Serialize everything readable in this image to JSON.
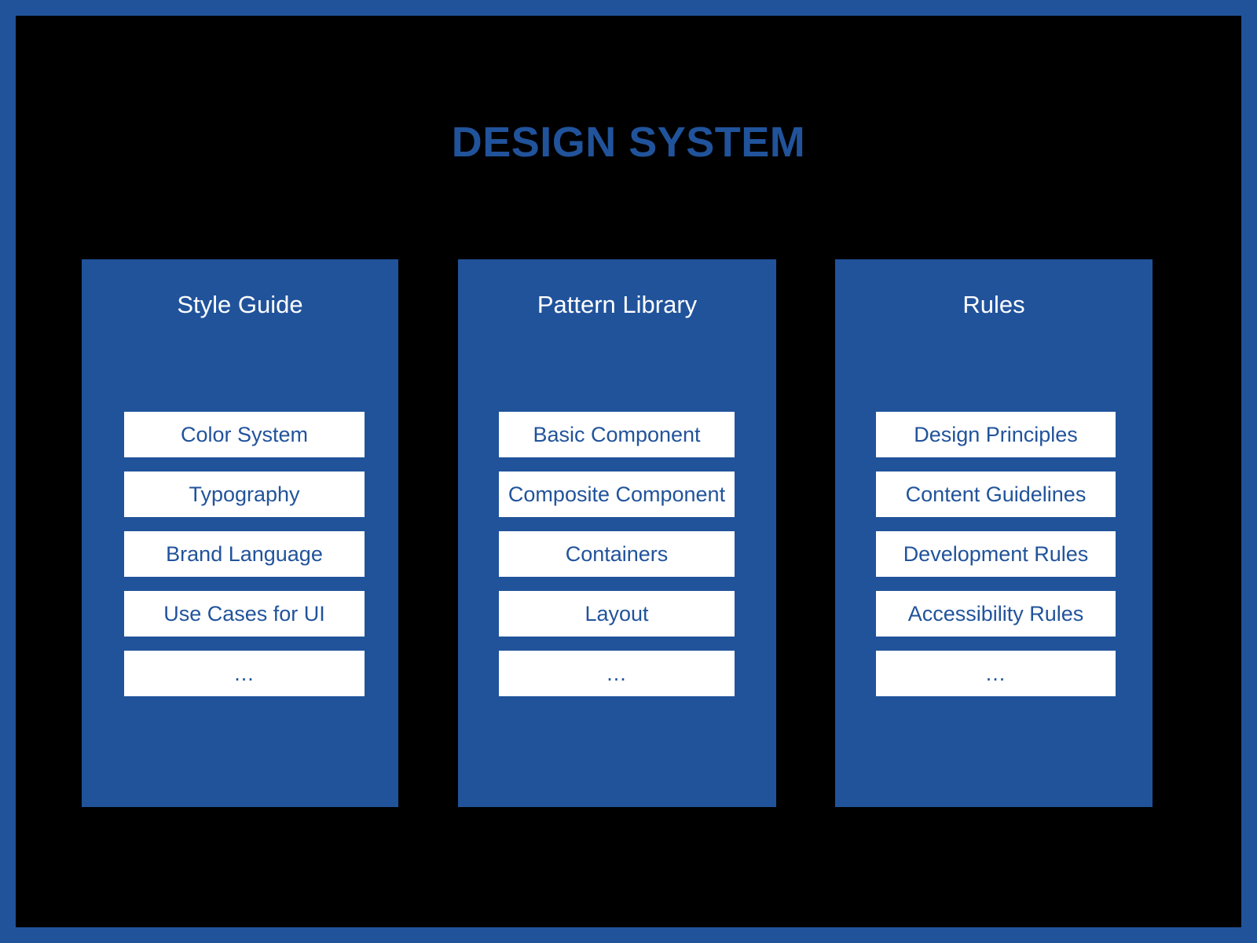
{
  "page": {
    "title": "DESIGN SYSTEM",
    "background_color": "#000000",
    "border_color": "#21539b",
    "accent_color": "#21539b",
    "card_text_color": "#ffffff",
    "item_text_color": "#21539b",
    "item_background_color": "#ffffff"
  },
  "columns": [
    {
      "title": "Style Guide",
      "items": [
        {
          "label": "Color System"
        },
        {
          "label": "Typography"
        },
        {
          "label": "Brand Language"
        },
        {
          "label": "Use Cases for UI"
        },
        {
          "label": "..."
        }
      ]
    },
    {
      "title": "Pattern Library",
      "items": [
        {
          "label": "Basic Component"
        },
        {
          "label": "Composite Component"
        },
        {
          "label": "Containers"
        },
        {
          "label": "Layout"
        },
        {
          "label": "..."
        }
      ]
    },
    {
      "title": "Rules",
      "items": [
        {
          "label": "Design Principles"
        },
        {
          "label": "Content Guidelines"
        },
        {
          "label": "Development Rules"
        },
        {
          "label": "Accessibility Rules"
        },
        {
          "label": "..."
        }
      ]
    }
  ]
}
